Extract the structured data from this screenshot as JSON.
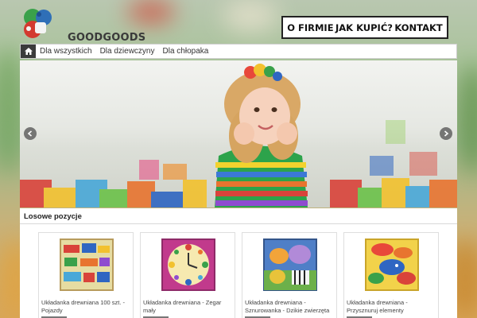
{
  "brand": {
    "name": "GOODGOODS"
  },
  "top_nav": {
    "items": [
      "O FIRMIE",
      "JAK KUPIĆ?",
      "KONTAKT"
    ]
  },
  "main_nav": {
    "home_icon": "home-icon",
    "items": [
      "Dla wszystkich",
      "Dla dziewczyny",
      "Dla chłopaka"
    ]
  },
  "slider": {
    "prev_icon": "chevron-left-icon",
    "next_icon": "chevron-right-icon"
  },
  "section": {
    "title": "Losowe pozycje"
  },
  "products": [
    {
      "name": "Układanka drewniana 100 szt. - Pojazdy"
    },
    {
      "name": "Układanka drewniana - Zegar mały"
    },
    {
      "name": "Układanka drewniana - Sznurowanka - Dzikie zwierzęta"
    },
    {
      "name": "Układanka drewniana - Przysznuruj elementy"
    }
  ],
  "colors": {
    "nav_dark": "#3b3b3b",
    "accent_red": "#d33a2f",
    "accent_green": "#3aa14a",
    "accent_blue": "#2f6fb7"
  }
}
